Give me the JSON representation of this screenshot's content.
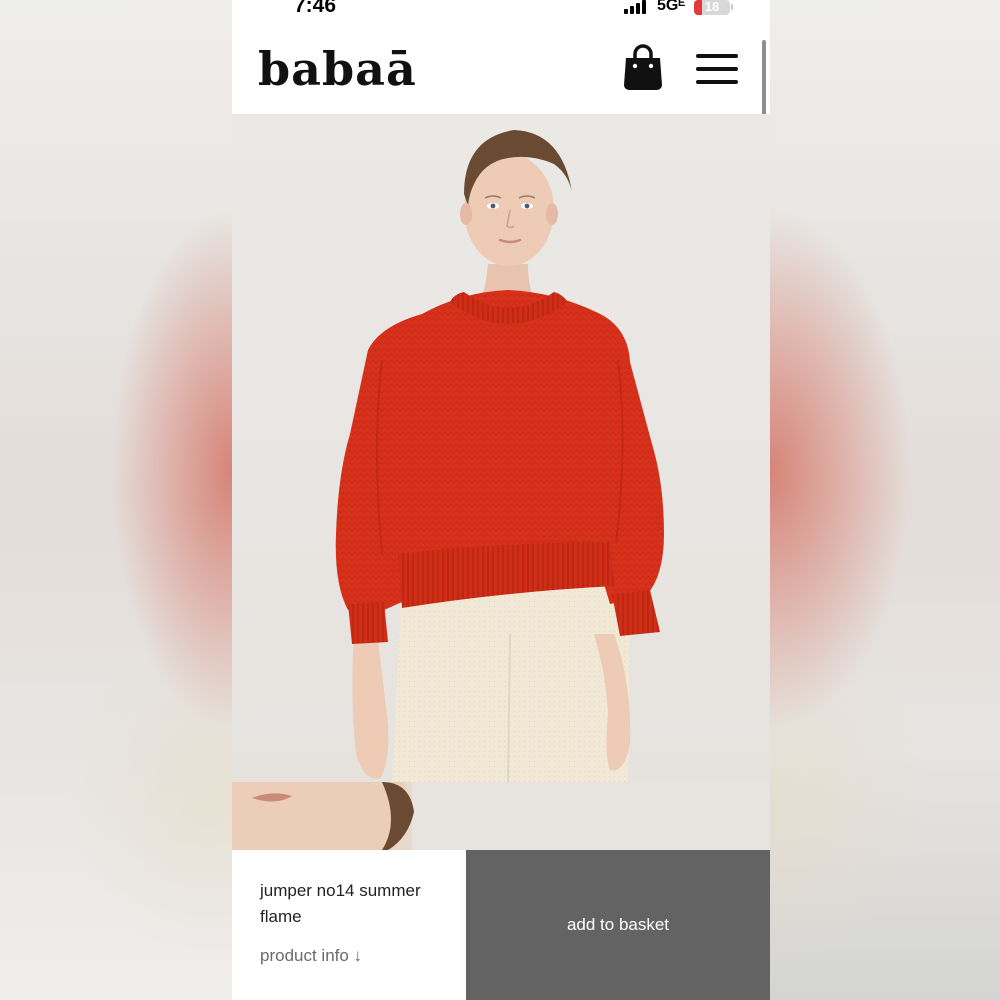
{
  "status_bar": {
    "time": "7:46",
    "network": "5Gᴱ",
    "battery": "18"
  },
  "header": {
    "logo": "babaā",
    "icons": [
      "shopping-bag-icon",
      "hamburger-menu-icon"
    ]
  },
  "product": {
    "name": "jumper no14 summer flame",
    "info_link": "product info ↓",
    "add_to_basket": "add to basket"
  },
  "colors": {
    "sweater": "#d8311b",
    "button_bg": "#636363",
    "photo_bg": "#e9e7e4",
    "shorts": "#f1e8d6"
  }
}
